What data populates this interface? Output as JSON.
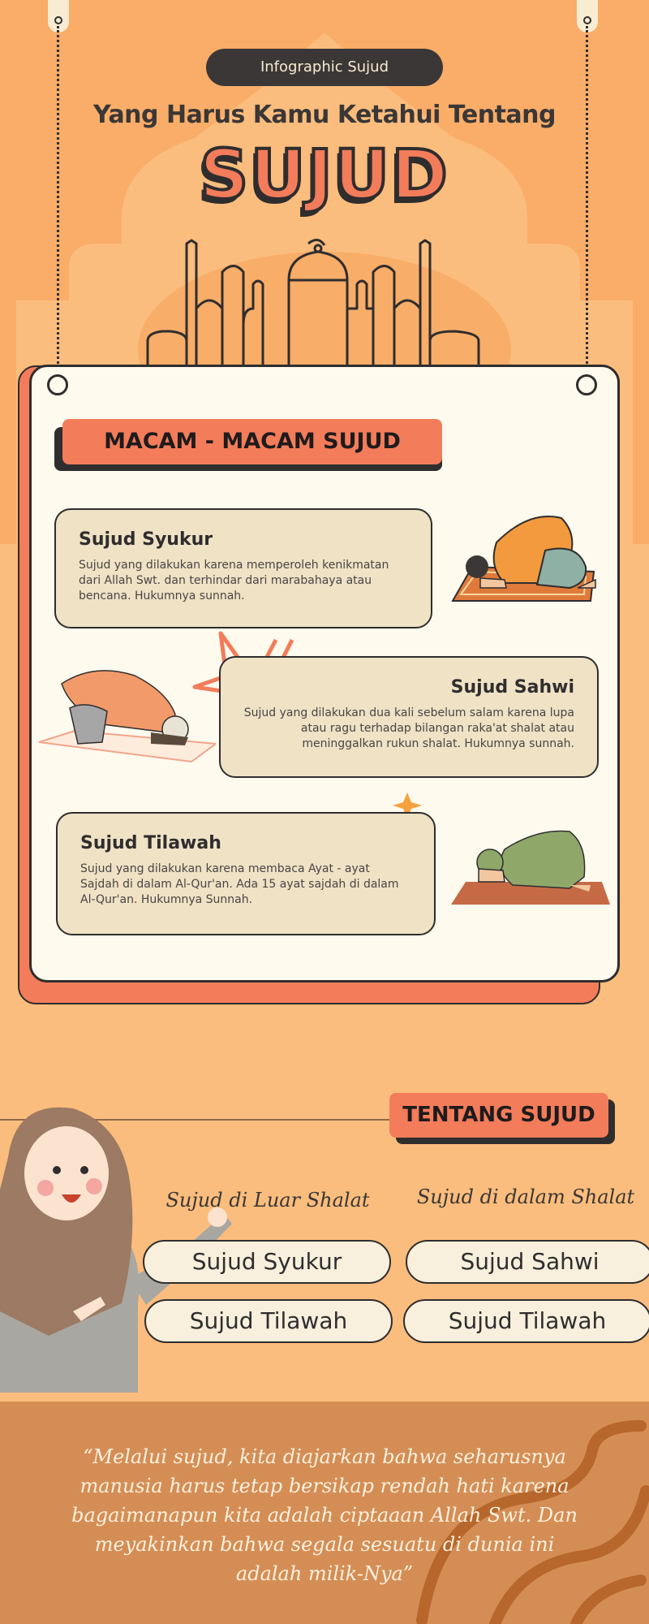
{
  "header": {
    "badge": "Infographic Sujud",
    "subtitle": "Yang Harus Kamu Ketahui Tentang",
    "title": "SUJUD"
  },
  "macam": {
    "heading": "MACAM - MACAM SUJUD",
    "items": [
      {
        "title": "Sujud Syukur",
        "desc": "Sujud yang dilakukan karena memperoleh kenikmatan dari Allah Swt. dan terhindar dari marabahaya atau bencana. Hukumnya sunnah."
      },
      {
        "title": "Sujud Sahwi",
        "desc": "Sujud yang dilakukan dua kali sebelum salam karena lupa atau ragu terhadap bilangan raka'at shalat atau meninggalkan rukun shalat. Hukumnya sunnah."
      },
      {
        "title": "Sujud Tilawah",
        "desc": "Sujud yang dilakukan karena membaca Ayat - ayat Sajdah di dalam Al-Qur'an. Ada 15 ayat sajdah di dalam Al-Qur'an. Hukumnya Sunnah."
      }
    ]
  },
  "tentang": {
    "heading": "TENTANG SUJUD",
    "columns": [
      {
        "heading": "Sujud di Luar Shalat",
        "items": [
          "Sujud Syukur",
          "Sujud Tilawah"
        ]
      },
      {
        "heading": "Sujud di dalam Shalat",
        "items": [
          "Sujud Sahwi",
          "Sujud Tilawah"
        ]
      }
    ]
  },
  "footer": {
    "quote": "“Melalui sujud, kita diajarkan bahwa seharusnya manusia harus tetap bersikap rendah hati karena bagaimanapun kita adalah ciptaaan Allah Swt. Dan meyakinkan bahwa segala sesuatu di dunia ini adalah milik-Nya”"
  },
  "colors": {
    "hero_bg": "#f9ad68",
    "accent": "#f37c5a",
    "dark": "#2f2d2e",
    "card_bg": "#fefaee",
    "box_bg": "#efe2c5",
    "footer_bg": "#d48e55"
  },
  "icons": [
    "mosque-outline-icon",
    "burst-decoration-icon",
    "sparkle-icon",
    "swirl-decoration-icon"
  ]
}
